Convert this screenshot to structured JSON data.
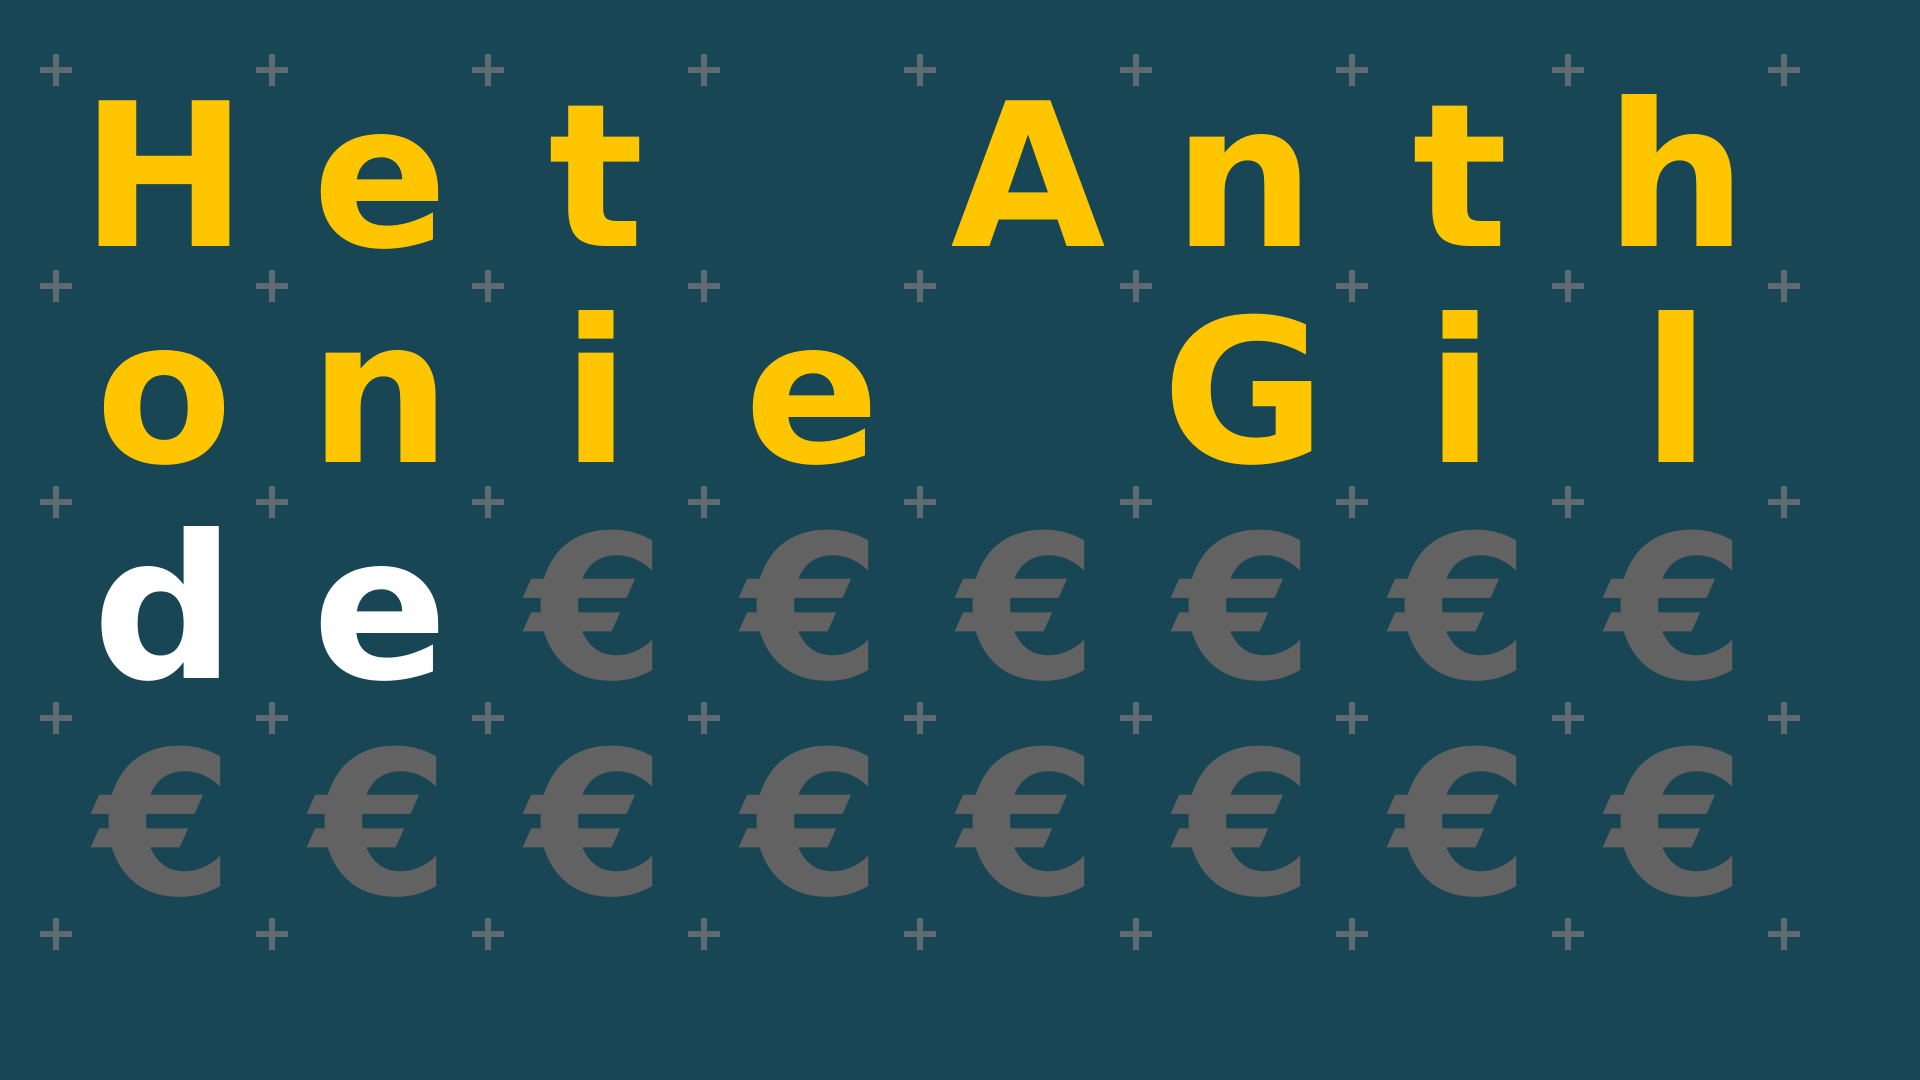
{
  "puzzle": {
    "letter_color": "#ffc600",
    "revealed_color": "#ffffff",
    "placeholder_color": "#626262",
    "background_color": "#184655",
    "grid_mark_color": "#5f6b72",
    "rows": [
      [
        {
          "char": "H",
          "state": "letter"
        },
        {
          "char": "e",
          "state": "letter"
        },
        {
          "char": "t",
          "state": "letter"
        },
        {
          "char": "",
          "state": "space"
        },
        {
          "char": "A",
          "state": "letter"
        },
        {
          "char": "n",
          "state": "letter"
        },
        {
          "char": "t",
          "state": "letter"
        },
        {
          "char": "h",
          "state": "letter"
        }
      ],
      [
        {
          "char": "o",
          "state": "letter"
        },
        {
          "char": "n",
          "state": "letter"
        },
        {
          "char": "i",
          "state": "letter"
        },
        {
          "char": "e",
          "state": "letter"
        },
        {
          "char": "",
          "state": "space"
        },
        {
          "char": "G",
          "state": "letter"
        },
        {
          "char": "i",
          "state": "letter"
        },
        {
          "char": "l",
          "state": "letter"
        }
      ],
      [
        {
          "char": "d",
          "state": "revealed"
        },
        {
          "char": "e",
          "state": "revealed"
        },
        {
          "char": "€",
          "state": "placeholder"
        },
        {
          "char": "€",
          "state": "placeholder"
        },
        {
          "char": "€",
          "state": "placeholder"
        },
        {
          "char": "€",
          "state": "placeholder"
        },
        {
          "char": "€",
          "state": "placeholder"
        },
        {
          "char": "€",
          "state": "placeholder"
        }
      ],
      [
        {
          "char": "€",
          "state": "placeholder"
        },
        {
          "char": "€",
          "state": "placeholder"
        },
        {
          "char": "€",
          "state": "placeholder"
        },
        {
          "char": "€",
          "state": "placeholder"
        },
        {
          "char": "€",
          "state": "placeholder"
        },
        {
          "char": "€",
          "state": "placeholder"
        },
        {
          "char": "€",
          "state": "placeholder"
        },
        {
          "char": "€",
          "state": "placeholder"
        }
      ]
    ]
  }
}
